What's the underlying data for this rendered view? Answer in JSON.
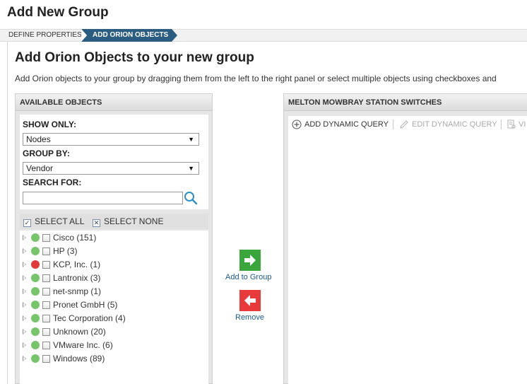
{
  "page": {
    "title": "Add New Group"
  },
  "wizard": {
    "steps": [
      {
        "label": "DEFINE PROPERTIES",
        "active": false
      },
      {
        "label": "ADD ORION OBJECTS",
        "active": true
      }
    ],
    "active_color": "#2b5d80"
  },
  "section": {
    "title": "Add Orion Objects to your new group",
    "description": "Add Orion objects to your group by dragging them from the left to the right panel or select multiple objects using checkboxes and"
  },
  "available": {
    "header": "AVAILABLE OBJECTS",
    "show_only": {
      "label": "SHOW ONLY:",
      "value": "Nodes"
    },
    "group_by": {
      "label": "GROUP BY:",
      "value": "Vendor"
    },
    "search": {
      "label": "SEARCH FOR:",
      "value": "",
      "placeholder": ""
    },
    "select_all": "SELECT ALL",
    "select_none": "SELECT NONE",
    "items": [
      {
        "label": "Cisco (151)",
        "status": "up"
      },
      {
        "label": "HP (3)",
        "status": "up"
      },
      {
        "label": "KCP, Inc. (1)",
        "status": "down"
      },
      {
        "label": "Lantronix (3)",
        "status": "up"
      },
      {
        "label": "net-snmp (1)",
        "status": "up"
      },
      {
        "label": "Pronet GmbH (5)",
        "status": "up"
      },
      {
        "label": "Tec Corporation (4)",
        "status": "up"
      },
      {
        "label": "Unknown (20)",
        "status": "up"
      },
      {
        "label": "VMware Inc. (6)",
        "status": "up"
      },
      {
        "label": "Windows (89)",
        "status": "up"
      }
    ],
    "status_colors": {
      "up": "#77c56a",
      "down": "#e23a3a"
    }
  },
  "actions": {
    "add_label": "Add to Group",
    "remove_label": "Remove",
    "add_color": "#3aa53a",
    "remove_color": "#e83a3a"
  },
  "group": {
    "header": "MELTON MOWBRAY STATION SWITCHES",
    "toolbar": {
      "add_query": "ADD DYNAMIC QUERY",
      "edit_query": "EDIT DYNAMIC QUERY",
      "view_partial": "VI"
    }
  }
}
